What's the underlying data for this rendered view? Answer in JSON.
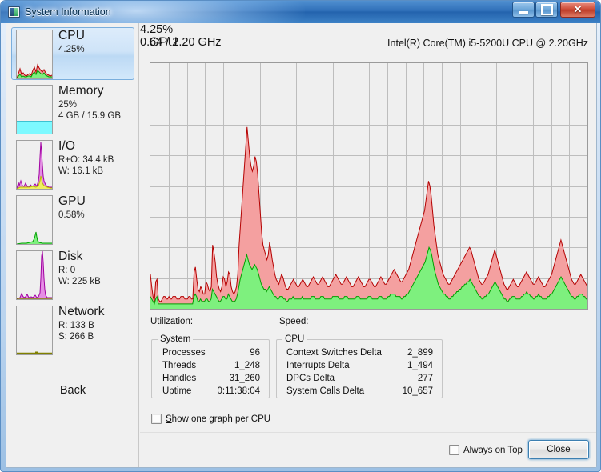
{
  "window": {
    "title": "System Information",
    "icon": "app-icon",
    "buttons": {
      "minimize": "minimize",
      "maximize": "maximize",
      "close": "✕"
    }
  },
  "sidebar": {
    "items": [
      {
        "id": "cpu",
        "title": "CPU",
        "selected": true,
        "lines": [
          "4.25%"
        ]
      },
      {
        "id": "memory",
        "title": "Memory",
        "selected": false,
        "lines": [
          "25%",
          "4 GB / 15.9 GB"
        ]
      },
      {
        "id": "io",
        "title": "I/O",
        "selected": false,
        "lines": [
          "R+O: 34.4 kB",
          "W: 16.1 kB"
        ]
      },
      {
        "id": "gpu",
        "title": "GPU",
        "selected": false,
        "lines": [
          "0.58%"
        ]
      },
      {
        "id": "disk",
        "title": "Disk",
        "selected": false,
        "lines": [
          "R: 0",
          "W: 225 kB"
        ]
      },
      {
        "id": "network",
        "title": "Network",
        "selected": false,
        "lines": [
          "R: 133 B",
          "S: 266 B"
        ]
      }
    ],
    "back_label": "Back"
  },
  "main": {
    "panel_title": "CPU",
    "cpu_model": "Intel(R) Core(TM) i5-5200U CPU @ 2.20GHz",
    "utilization_label": "Utilization:",
    "utilization_value": "4.25%",
    "speed_label": "Speed:",
    "speed_value": "0.64 / 2.20 GHz",
    "groups": [
      {
        "legend": "System",
        "rows": [
          {
            "name": "Processes",
            "value": "96"
          },
          {
            "name": "Threads",
            "value": "1_248"
          },
          {
            "name": "Handles",
            "value": "31_260"
          },
          {
            "name": "Uptime",
            "value": "0:11:38:04"
          }
        ]
      },
      {
        "legend": "CPU",
        "rows": [
          {
            "name": "Context Switches Delta",
            "value": "2_899"
          },
          {
            "name": "Interrupts Delta",
            "value": "1_494"
          },
          {
            "name": "DPCs Delta",
            "value": "277"
          },
          {
            "name": "System Calls Delta",
            "value": "10_657"
          }
        ]
      }
    ],
    "show_one_graph_label": "Show one graph per CPU",
    "show_one_graph_accel": "S",
    "show_one_graph_rest": "how one graph per CPU",
    "show_one_graph_checked": false
  },
  "footer": {
    "always_on_top_label": "Always on Top",
    "always_on_top_pre": "Always on ",
    "always_on_top_accel": "T",
    "always_on_top_post": "op",
    "always_on_top_checked": false,
    "close_label": "Close"
  },
  "colors": {
    "total_line": "#b40000",
    "total_fill": "#f4a0a0",
    "kernel_line": "#00a000",
    "kernel_fill": "#7ef07e",
    "grid": "#bdbdbd",
    "plot_bg": "#efefef",
    "memory_fill": "#7df9ff",
    "io_fill": "#e58ee5",
    "io_line": "#a000a0",
    "io_sub_fill": "#f0f060",
    "disk_fill": "#e58ee5",
    "disk_line": "#a000a0",
    "network_baseline": "#808000",
    "accent": "#3c7fb1"
  },
  "chart_data": {
    "type": "area",
    "title": "CPU",
    "subtitle": "Intel(R) Core(TM) i5-5200U CPU @ 2.20GHz",
    "xlabel": "",
    "ylabel": "",
    "ylim": [
      0,
      100
    ],
    "grid": true,
    "grid_rows": 8,
    "grid_cols": 24,
    "legend": "none",
    "series": [
      {
        "name": "Total CPU Usage",
        "line_color": "#b40000",
        "fill_color": "#f4a0a0",
        "values": [
          14,
          9,
          5,
          3,
          11,
          12,
          4,
          3,
          3,
          4,
          5,
          5,
          4,
          4,
          5,
          4,
          4,
          5,
          5,
          5,
          4,
          4,
          4,
          5,
          5,
          5,
          4,
          4,
          4,
          5,
          5,
          4,
          4,
          15,
          17,
          12,
          8,
          7,
          9,
          8,
          6,
          6,
          11,
          10,
          8,
          7,
          9,
          26,
          23,
          19,
          13,
          10,
          8,
          7,
          9,
          13,
          12,
          9,
          11,
          15,
          14,
          9,
          7,
          6,
          7,
          9,
          14,
          26,
          34,
          42,
          50,
          58,
          66,
          74,
          68,
          62,
          58,
          56,
          58,
          62,
          60,
          55,
          47,
          39,
          31,
          26,
          24,
          22,
          20,
          22,
          27,
          24,
          20,
          17,
          14,
          12,
          11,
          10,
          12,
          14,
          13,
          11,
          9,
          8,
          8,
          9,
          10,
          11,
          12,
          11,
          10,
          9,
          9,
          10,
          11,
          12,
          11,
          10,
          9,
          9,
          10,
          11,
          12,
          13,
          12,
          11,
          10,
          10,
          11,
          12,
          13,
          12,
          11,
          10,
          9,
          9,
          10,
          11,
          12,
          13,
          14,
          13,
          12,
          11,
          10,
          10,
          11,
          12,
          13,
          12,
          11,
          10,
          9,
          9,
          10,
          11,
          12,
          13,
          12,
          11,
          10,
          9,
          9,
          10,
          11,
          12,
          12,
          11,
          10,
          9,
          9,
          10,
          11,
          12,
          13,
          12,
          11,
          10,
          10,
          11,
          12,
          13,
          14,
          15,
          16,
          15,
          14,
          13,
          12,
          11,
          11,
          12,
          13,
          14,
          15,
          16,
          18,
          20,
          22,
          24,
          26,
          28,
          30,
          32,
          34,
          36,
          38,
          40,
          44,
          48,
          52,
          50,
          46,
          40,
          34,
          30,
          26,
          22,
          20,
          18,
          16,
          14,
          13,
          12,
          11,
          10,
          10,
          11,
          12,
          13,
          14,
          15,
          16,
          17,
          18,
          19,
          20,
          21,
          22,
          23,
          24,
          25,
          24,
          22,
          20,
          18,
          16,
          14,
          12,
          11,
          10,
          10,
          11,
          12,
          13,
          14,
          16,
          18,
          20,
          22,
          24,
          22,
          20,
          18,
          16,
          14,
          12,
          10,
          9,
          8,
          8,
          9,
          10,
          11,
          12,
          11,
          10,
          9,
          9,
          10,
          11,
          12,
          13,
          14,
          15,
          14,
          13,
          12,
          11,
          10,
          10,
          11,
          12,
          13,
          12,
          11,
          10,
          9,
          9,
          10,
          11,
          12,
          13,
          14,
          16,
          18,
          20,
          22,
          24,
          26,
          28,
          26,
          24,
          22,
          20,
          18,
          16,
          14,
          12,
          11,
          10,
          10,
          11,
          12,
          13,
          14,
          13,
          12,
          11,
          10,
          9
        ]
      },
      {
        "name": "Kernel CPU Usage",
        "line_color": "#00a000",
        "fill_color": "#7ef07e",
        "values": [
          5,
          4,
          3,
          2,
          4,
          5,
          2,
          2,
          2,
          2,
          2,
          2,
          2,
          2,
          2,
          2,
          2,
          2,
          2,
          2,
          2,
          2,
          2,
          2,
          2,
          2,
          2,
          2,
          2,
          2,
          2,
          2,
          2,
          5,
          6,
          5,
          3,
          3,
          4,
          3,
          3,
          3,
          4,
          4,
          3,
          3,
          4,
          8,
          7,
          6,
          5,
          4,
          3,
          3,
          4,
          5,
          5,
          4,
          4,
          6,
          5,
          4,
          3,
          3,
          3,
          4,
          6,
          9,
          12,
          14,
          16,
          18,
          20,
          22,
          20,
          18,
          17,
          16,
          17,
          18,
          17,
          16,
          14,
          12,
          10,
          9,
          8,
          8,
          7,
          8,
          9,
          8,
          7,
          6,
          5,
          5,
          4,
          4,
          5,
          5,
          5,
          4,
          4,
          3,
          3,
          4,
          4,
          4,
          5,
          4,
          4,
          4,
          4,
          4,
          4,
          5,
          4,
          4,
          4,
          4,
          4,
          4,
          5,
          5,
          5,
          4,
          4,
          4,
          4,
          5,
          5,
          5,
          4,
          4,
          4,
          4,
          4,
          4,
          5,
          5,
          5,
          5,
          5,
          4,
          4,
          4,
          4,
          5,
          5,
          5,
          4,
          4,
          4,
          4,
          4,
          4,
          5,
          5,
          5,
          4,
          4,
          4,
          4,
          4,
          4,
          5,
          5,
          5,
          4,
          4,
          4,
          4,
          4,
          5,
          5,
          5,
          4,
          4,
          4,
          4,
          5,
          5,
          6,
          6,
          6,
          6,
          5,
          5,
          5,
          5,
          4,
          4,
          5,
          5,
          6,
          6,
          7,
          8,
          9,
          10,
          11,
          12,
          13,
          14,
          15,
          16,
          17,
          18,
          19,
          21,
          23,
          25,
          24,
          22,
          19,
          16,
          14,
          12,
          10,
          9,
          8,
          7,
          6,
          6,
          5,
          5,
          4,
          4,
          5,
          5,
          6,
          6,
          7,
          7,
          8,
          8,
          9,
          9,
          10,
          10,
          11,
          11,
          12,
          11,
          10,
          9,
          8,
          7,
          6,
          5,
          5,
          4,
          4,
          5,
          5,
          6,
          6,
          7,
          8,
          9,
          10,
          11,
          10,
          9,
          8,
          7,
          6,
          5,
          4,
          4,
          3,
          3,
          4,
          4,
          5,
          5,
          5,
          4,
          4,
          4,
          4,
          5,
          5,
          6,
          6,
          7,
          6,
          6,
          5,
          5,
          4,
          4,
          5,
          5,
          6,
          5,
          5,
          4,
          4,
          4,
          4,
          5,
          5,
          6,
          6,
          7,
          8,
          9,
          10,
          11,
          12,
          13,
          12,
          11,
          10,
          9,
          8,
          7,
          6,
          5,
          5,
          4,
          4,
          5,
          5,
          6,
          6,
          6,
          5,
          5,
          4,
          4
        ]
      }
    ]
  }
}
